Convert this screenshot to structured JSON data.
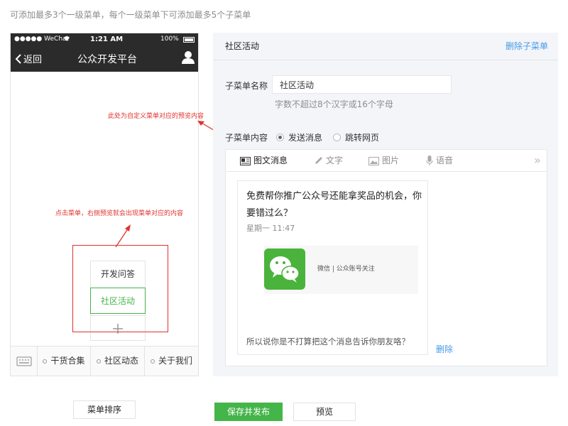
{
  "top_hint": "可添加最多3个一级菜单，每个一级菜单下可添加最多5个子菜单",
  "phone": {
    "status": {
      "carrier": "●●●●● WeChat",
      "time": "1:21 AM",
      "battery": "100%"
    },
    "nav": {
      "back_label": "返回",
      "title": "公众开发平台"
    },
    "menu": [
      {
        "label": "干货合集"
      },
      {
        "label": "社区动态"
      },
      {
        "label": "关于我们"
      }
    ],
    "submenu": [
      {
        "label": "开发问答"
      },
      {
        "label": "社区活动",
        "active": true
      }
    ]
  },
  "annotations": {
    "preview_note": "此处为自定义菜单对应的预览内容",
    "click_note": "点击菜单，右侧预览就会出现菜单对应的内容"
  },
  "editor": {
    "title": "社区活动",
    "delete_label": "删除子菜单",
    "name_label": "子菜单名称",
    "name_value": "社区活动",
    "name_tip": "字数不超过8个汉字或16个字母",
    "content_label": "子菜单内容",
    "radio_options": [
      {
        "label": "发送消息",
        "checked": true
      },
      {
        "label": "跳转网页",
        "checked": false
      }
    ],
    "tabs": [
      {
        "label": "图文消息",
        "icon": "news-icon",
        "active": true
      },
      {
        "label": "文字",
        "icon": "pencil-icon"
      },
      {
        "label": "图片",
        "icon": "image-icon"
      },
      {
        "label": "语音",
        "icon": "microphone-icon"
      }
    ],
    "tabs_more": "»",
    "card": {
      "title": "免费帮你推广公众号还能拿奖品的机会，你要错过么？",
      "date": "星期一 11:47",
      "thumb_text": "微信 | 公众账号关注",
      "description": "所以说你是不打算把这个消息告诉你朋友咯？",
      "delete_label": "删除"
    }
  },
  "buttons": {
    "sort": "菜单排序",
    "save": "保存并发布",
    "preview": "预览"
  },
  "colors": {
    "accent_green": "#44b549",
    "link_blue": "#459ae9",
    "annotation_red": "#e0322c",
    "phone_header": "#2b2b2b"
  }
}
